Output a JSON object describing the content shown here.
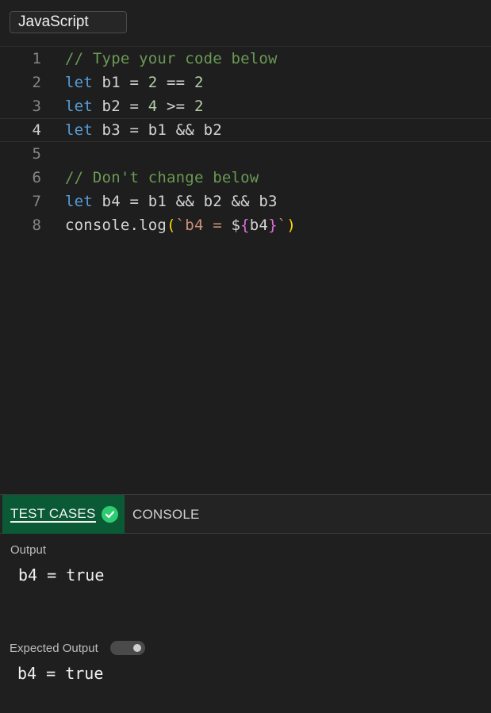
{
  "language": "JavaScript",
  "editor": {
    "lines": [
      {
        "num": "1",
        "tokens": [
          {
            "t": "// Type your code below",
            "c": "cm"
          }
        ]
      },
      {
        "num": "2",
        "tokens": [
          {
            "t": "let",
            "c": "kw"
          },
          {
            "t": " b1 = ",
            "c": ""
          },
          {
            "t": "2",
            "c": "num"
          },
          {
            "t": " == ",
            "c": ""
          },
          {
            "t": "2",
            "c": "num"
          }
        ]
      },
      {
        "num": "3",
        "tokens": [
          {
            "t": "let",
            "c": "kw"
          },
          {
            "t": " b2 = ",
            "c": ""
          },
          {
            "t": "4",
            "c": "num"
          },
          {
            "t": " >= ",
            "c": ""
          },
          {
            "t": "2",
            "c": "num"
          }
        ]
      },
      {
        "num": "4",
        "tokens": [
          {
            "t": "let",
            "c": "kw"
          },
          {
            "t": " b3 = b1 && b2",
            "c": ""
          }
        ]
      },
      {
        "num": "5",
        "tokens": []
      },
      {
        "num": "6",
        "tokens": [
          {
            "t": "// Don't change below",
            "c": "cm"
          }
        ]
      },
      {
        "num": "7",
        "tokens": [
          {
            "t": "let",
            "c": "kw"
          },
          {
            "t": " b4 = b1 && b2 && b3",
            "c": ""
          }
        ]
      },
      {
        "num": "8",
        "tokens": [
          {
            "t": "console.log",
            "c": ""
          },
          {
            "t": "(",
            "c": "paren"
          },
          {
            "t": "`b4 = ",
            "c": "str"
          },
          {
            "t": "$",
            "c": ""
          },
          {
            "t": "{",
            "c": "brace"
          },
          {
            "t": "b4",
            "c": ""
          },
          {
            "t": "}",
            "c": "brace"
          },
          {
            "t": "`",
            "c": "str"
          },
          {
            "t": ")",
            "c": "paren"
          }
        ]
      }
    ]
  },
  "tabs": {
    "test_cases": "TEST CASES",
    "console": "CONSOLE"
  },
  "output": {
    "label": "Output",
    "value": "b4 = true"
  },
  "expected": {
    "label": "Expected Output",
    "value": "b4 = true"
  },
  "colors": {
    "accent_green": "#2ecc71",
    "tab_active_bg": "#0b5a36"
  },
  "icons": {
    "test_status": "check-circle-icon"
  }
}
